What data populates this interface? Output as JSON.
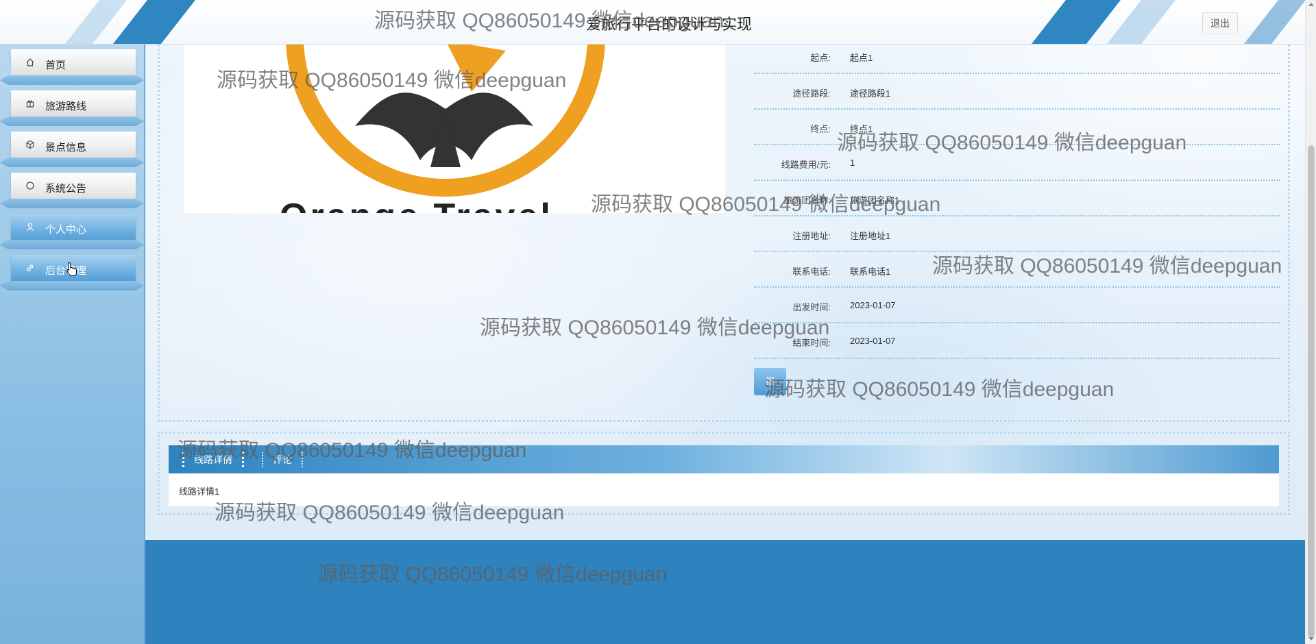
{
  "header": {
    "title": "爱旅行平台的设计与实现",
    "logout_label": "退出"
  },
  "sidebar": {
    "items": [
      {
        "label": "首页",
        "icon": "home-icon"
      },
      {
        "label": "旅游路线",
        "icon": "gift-icon"
      },
      {
        "label": "景点信息",
        "icon": "cube-icon"
      },
      {
        "label": "系统公告",
        "icon": "circle-icon"
      },
      {
        "label": "个人中心",
        "icon": "user-icon"
      },
      {
        "label": "后台管理",
        "icon": "link-icon"
      }
    ]
  },
  "details": [
    {
      "label": "起点:",
      "value": "起点1"
    },
    {
      "label": "途径路段:",
      "value": "途径路段1"
    },
    {
      "label": "终点:",
      "value": "终点1"
    },
    {
      "label": "线路费用/元:",
      "value": "1"
    },
    {
      "label": "旅游团名称:",
      "value": "旅游团名称1"
    },
    {
      "label": "注册地址:",
      "value": "注册地址1"
    },
    {
      "label": "联系电话:",
      "value": "联系电话1"
    },
    {
      "label": "出发时间:",
      "value": "2023-01-07"
    },
    {
      "label": "结束时间:",
      "value": "2023-01-07"
    }
  ],
  "action_button_label": "报",
  "tabs": [
    {
      "label": "线路详情",
      "active": true
    },
    {
      "label": "评论",
      "active": false
    }
  ],
  "tab_content": "线路详情1",
  "image_text": "Orange Travel",
  "watermark_text": "源码获取 QQ86050149 微信deepguan",
  "colors": {
    "primary_blue": "#2e82bd",
    "sidebar_blue": "#8bbfe3",
    "logo_orange": "#f0a020"
  }
}
